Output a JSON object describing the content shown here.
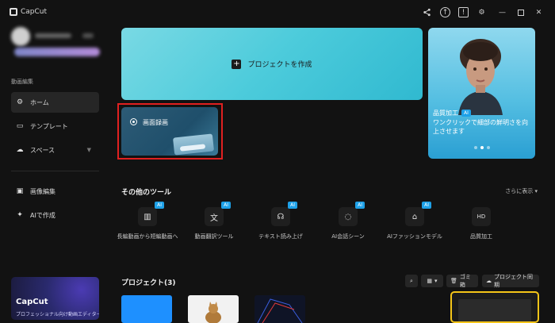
{
  "app": {
    "name": "CapCut"
  },
  "titlebar": {
    "icons": [
      "share-icon",
      "upload-icon",
      "message-icon",
      "settings-icon",
      "minimize-icon",
      "maximize-icon",
      "close-icon"
    ]
  },
  "sidebar": {
    "section_label": "動画編集",
    "items": [
      {
        "label": "ホーム",
        "icon": "home-icon"
      },
      {
        "label": "テンプレート",
        "icon": "template-icon"
      },
      {
        "label": "スペース",
        "icon": "cloud-icon"
      },
      {
        "label": "画像編集",
        "icon": "image-icon"
      },
      {
        "label": "AIで作成",
        "icon": "sparkle-icon"
      }
    ],
    "promo": {
      "title": "CapCut",
      "subtitle": "プロフェッショナル向け動画エディター"
    }
  },
  "main": {
    "create_label": "プロジェクトを作成",
    "record_label": "画面録画",
    "promo_card": {
      "title": "品質加工",
      "badge": "AI",
      "description": "ワンクリックで細部の鮮明さを向上させます"
    },
    "tools_title": "その他のツール",
    "more_label": "さらに表示",
    "tools": [
      {
        "label": "長編動画から短編動画へ",
        "badge": "AI",
        "icon": "film-icon"
      },
      {
        "label": "動画翻訳ツール",
        "badge": "AI",
        "icon": "translate-icon"
      },
      {
        "label": "テキスト読み上げ",
        "badge": "AI",
        "icon": "speech-icon"
      },
      {
        "label": "AI会話シーン",
        "badge": "AI",
        "icon": "chat-icon"
      },
      {
        "label": "AIファッションモデル",
        "badge": "AI",
        "icon": "shirt-icon"
      },
      {
        "label": "品質加工",
        "badge": "",
        "icon": "hd-icon"
      }
    ],
    "projects": {
      "title": "プロジェクト(3)",
      "trash_label": "ゴミ箱",
      "sync_label": "プロジェクト同期"
    }
  },
  "colors": {
    "accent": "#30b9d0",
    "highlight": "#e02020",
    "badge": "#1ea1e8",
    "selection": "#f5c518"
  }
}
